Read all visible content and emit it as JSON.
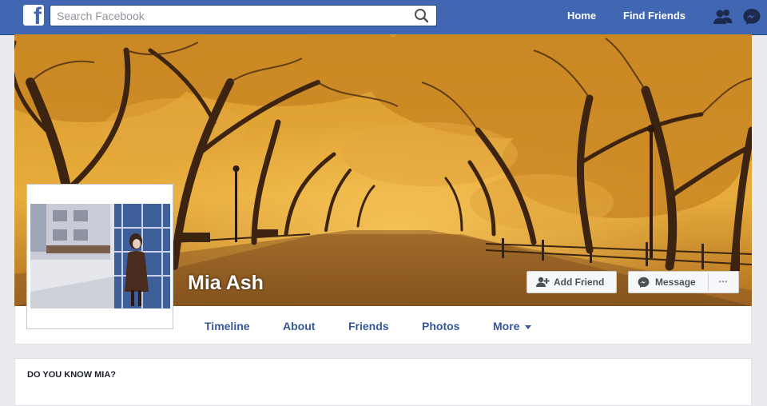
{
  "topbar": {
    "logo_letter": "f",
    "search_placeholder": "Search Facebook",
    "home_label": "Home",
    "find_friends_label": "Find Friends",
    "icons": [
      "facebook-logo-icon",
      "search-icon",
      "friend-requests-icon",
      "messenger-icon"
    ],
    "color": "#4267b2"
  },
  "profile": {
    "name": "Mia Ash",
    "add_friend_label": "Add Friend",
    "message_label": "Message",
    "more_options_label": "•••"
  },
  "tabs": [
    {
      "label": "Timeline"
    },
    {
      "label": "About"
    },
    {
      "label": "Friends"
    },
    {
      "label": "Photos"
    },
    {
      "label": "More"
    }
  ],
  "panel": {
    "title": "DO YOU KNOW MIA?"
  },
  "colors": {
    "link": "#365899",
    "cover_tone": "#c88a22"
  }
}
